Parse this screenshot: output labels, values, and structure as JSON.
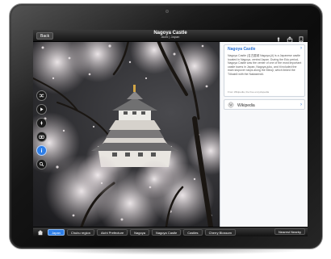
{
  "topbar": {
    "back_label": "Back",
    "title": "Nagoya Castle",
    "subtitle": "Aichi | Japan"
  },
  "sidepanel": {
    "article": {
      "title": "Nagoya Castle",
      "text": "Nagoya Castle (名古屋城 Nagoya-jō) is a Japanese castle located in Nagoya, central Japan. During the Edo period, Nagoya Castle was the center of one of the most important castle towns in Japan, Nagoya-juku, and it included the main stopover stops along the Minoji, which linked the Tōkaidō with the Nakasendō.",
      "footer": "From Wikipedia, the free encyclopedia"
    },
    "wikipedia": {
      "title": "Wikipedia"
    }
  },
  "bottombar": {
    "tags": [
      {
        "label": "Japan"
      },
      {
        "label": "Chubu region"
      },
      {
        "label": "Aichi Prefecture"
      },
      {
        "label": "Nagoya"
      },
      {
        "label": "Nagoya Castle"
      },
      {
        "label": "Castles"
      },
      {
        "label": "Cherry Blossom"
      }
    ],
    "active_index": 0,
    "nearest_label": "Nearest Nearby"
  },
  "colors": {
    "accent": "#2e7ee6",
    "link": "#2a72d4"
  },
  "icons": {
    "toolbar": [
      "shuffle-icon",
      "play-icon",
      "compass-icon",
      "camera-icon",
      "info-icon",
      "search-icon"
    ],
    "top": [
      "pin-icon",
      "share-icon",
      "bookmark-icon"
    ]
  }
}
